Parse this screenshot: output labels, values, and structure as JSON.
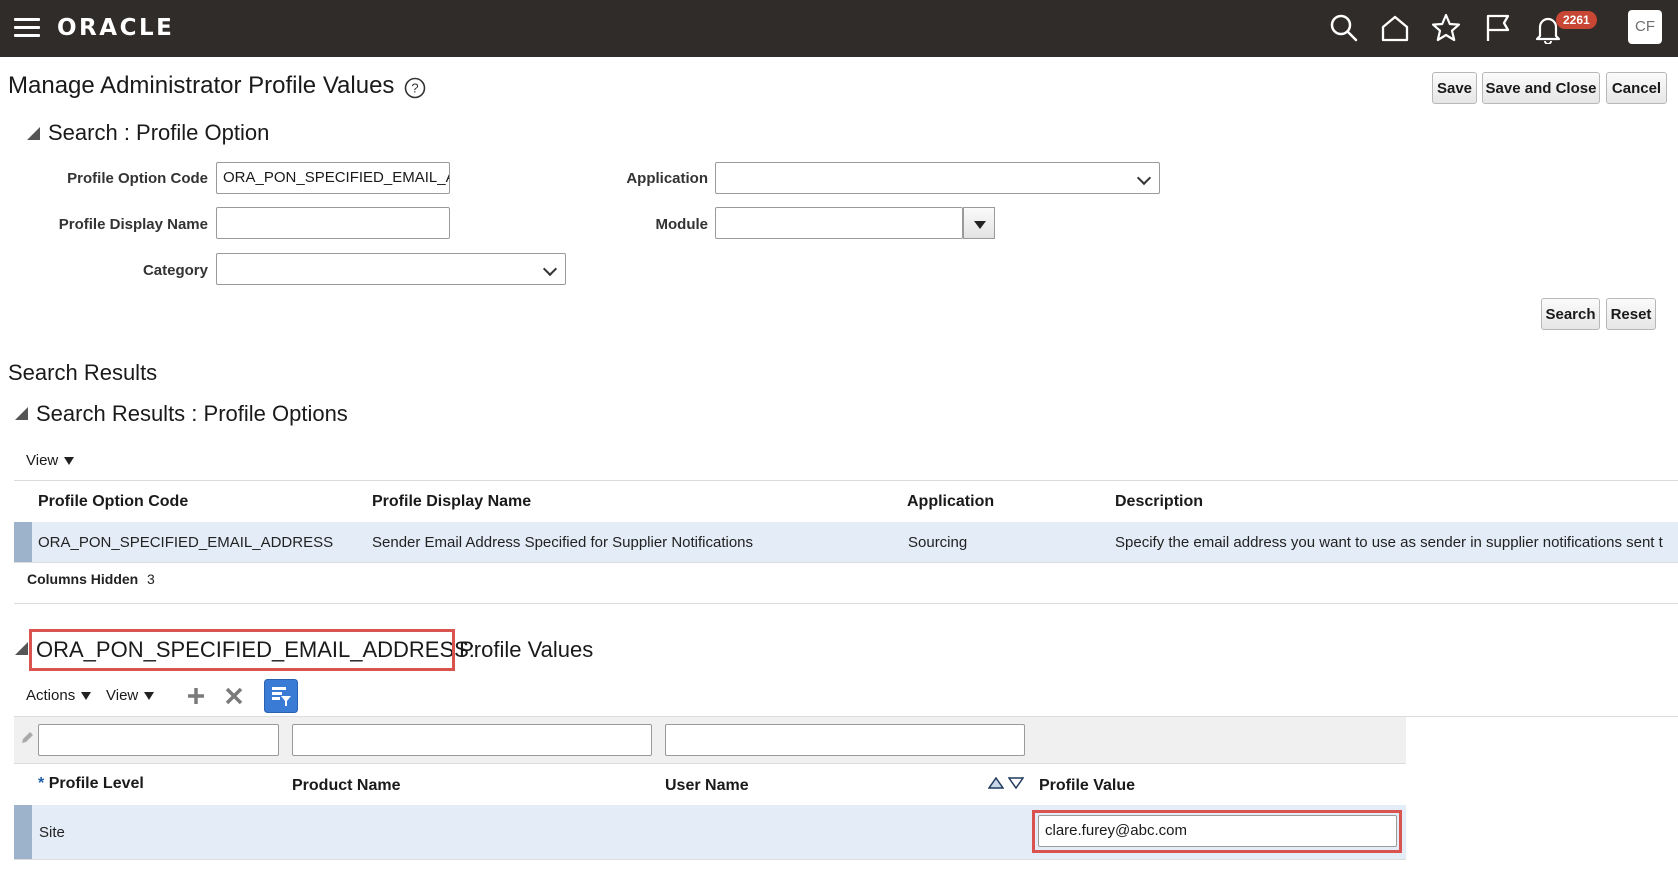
{
  "topbar": {
    "logo": "ORACLE",
    "notifications_count": "2261",
    "user_initials": "CF",
    "icons": [
      "menu-icon",
      "search-icon",
      "home-icon",
      "star-icon",
      "flag-icon",
      "bell-icon"
    ]
  },
  "header": {
    "title": "Manage Administrator Profile Values",
    "buttons": {
      "save": "Save",
      "save_close": "Save and Close",
      "cancel": "Cancel"
    }
  },
  "search": {
    "title": "Search : Profile Option",
    "fields": {
      "profile_option_code_label": "Profile Option Code",
      "profile_option_code_value": "ORA_PON_SPECIFIED_EMAIL_AD",
      "profile_display_name_label": "Profile Display Name",
      "profile_display_name_value": "",
      "category_label": "Category",
      "category_value": "",
      "application_label": "Application",
      "application_value": "",
      "module_label": "Module",
      "module_value": ""
    },
    "buttons": {
      "search": "Search",
      "reset": "Reset"
    }
  },
  "results": {
    "heading": "Search Results",
    "title": "Search Results : Profile Options",
    "view_label": "View",
    "columns": [
      "Profile Option Code",
      "Profile Display Name",
      "Application",
      "Description"
    ],
    "rows": [
      {
        "code": "ORA_PON_SPECIFIED_EMAIL_ADDRESS",
        "display_name": "Sender Email Address Specified for Supplier Notifications",
        "application": "Sourcing",
        "description": "Specify the email address you want to use as sender in supplier notifications sent to c"
      }
    ],
    "columns_hidden_label": "Columns Hidden",
    "columns_hidden_count": "3"
  },
  "profile_values": {
    "title_code": "ORA_PON_SPECIFIED_EMAIL_ADDRESS:",
    "title_suffix": " Profile Values",
    "actions_label": "Actions",
    "view_label": "View",
    "columns": {
      "profile_level": "Profile Level",
      "product_name": "Product Name",
      "user_name": "User Name",
      "profile_value": "Profile Value"
    },
    "required_marker": "*",
    "rows": [
      {
        "profile_level": "Site",
        "product_name": "",
        "user_name": "",
        "profile_value": "clare.furey@abc.com"
      }
    ]
  },
  "colors": {
    "topbar": "#302c29",
    "badge": "#c74634",
    "highlight_box": "#d9534f",
    "selected_row": "#e4edf7",
    "filter_button": "#3a7bd5"
  }
}
